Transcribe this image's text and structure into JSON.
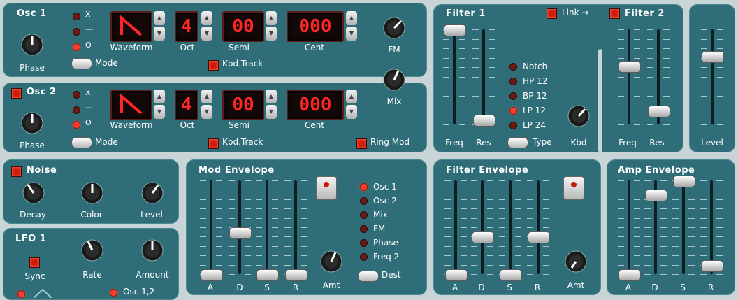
{
  "osc1": {
    "title": "Osc 1",
    "phase": "Phase",
    "mode": "Mode",
    "waveform": "Waveform",
    "oct": "Oct",
    "semi": "Semi",
    "cent": "Cent",
    "kbd_track": "Kbd.Track",
    "disp_oct": "4",
    "disp_semi": "00",
    "disp_cent": "000",
    "x": "X",
    "dash": "—",
    "o": "O"
  },
  "osc2": {
    "title": "Osc 2",
    "phase": "Phase",
    "mode": "Mode",
    "waveform": "Waveform",
    "oct": "Oct",
    "semi": "Semi",
    "cent": "Cent",
    "kbd_track": "Kbd.Track",
    "ring_mod": "Ring Mod",
    "disp_oct": "4",
    "disp_semi": "00",
    "disp_cent": "000",
    "x": "X",
    "dash": "—",
    "o": "O"
  },
  "fm": {
    "fm": "FM",
    "mix": "Mix"
  },
  "noise": {
    "title": "Noise",
    "decay": "Decay",
    "color": "Color",
    "level": "Level"
  },
  "lfo": {
    "title": "LFO 1",
    "sync": "Sync",
    "rate": "Rate",
    "amount": "Amount",
    "dest": "Osc 1,2"
  },
  "mod_env": {
    "title": "Mod Envelope",
    "a": "A",
    "d": "D",
    "s": "S",
    "r": "R",
    "amt": "Amt",
    "dest_btn": "Dest",
    "dests": [
      "Osc 1",
      "Osc 2",
      "Mix",
      "FM",
      "Phase",
      "Freq 2"
    ],
    "values": {
      "a": 0.0,
      "d": 0.45,
      "s": 0.0,
      "r": 0.0
    }
  },
  "filter1": {
    "title": "Filter 1",
    "freq": "Freq",
    "res": "Res",
    "type": "Type",
    "kbd": "Kbd",
    "types": [
      "Notch",
      "HP 12",
      "BP 12",
      "LP 12",
      "LP 24"
    ],
    "link": "Link →",
    "values": {
      "freq": 1.0,
      "res": 0.05
    }
  },
  "filter2": {
    "title": "Filter 2",
    "freq": "Freq",
    "res": "Res",
    "values": {
      "freq": 0.62,
      "res": 0.15
    }
  },
  "level": {
    "title": "Level",
    "value": 0.72
  },
  "filter_env": {
    "title": "Filter Envelope",
    "a": "A",
    "d": "D",
    "s": "S",
    "r": "R",
    "amt": "Amt",
    "values": {
      "a": 0.0,
      "d": 0.4,
      "s": 0.0,
      "r": 0.4
    }
  },
  "amp_env": {
    "title": "Amp Envelope",
    "a": "A",
    "d": "D",
    "s": "S",
    "r": "R",
    "values": {
      "a": 0.0,
      "d": 0.85,
      "s": 1.0,
      "r": 0.1
    }
  },
  "colors": {
    "panel": "#2f6e78",
    "led_on": "#ff3b2a",
    "display": "#ff2626",
    "background": "#c9d4d6"
  }
}
